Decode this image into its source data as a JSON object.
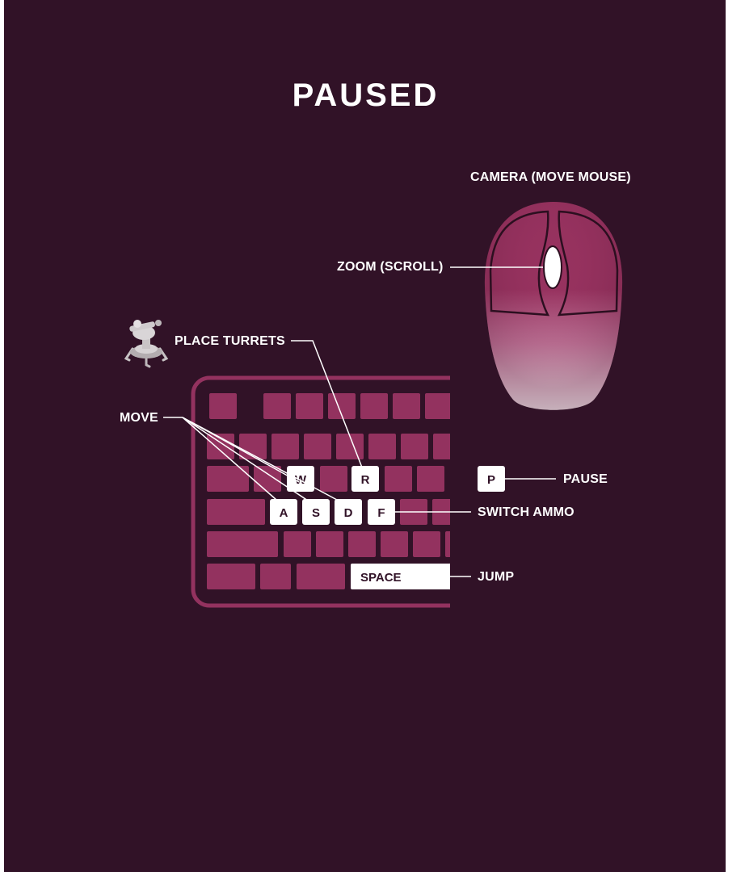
{
  "title": "PAUSED",
  "colors": {
    "background": "#311227",
    "key": "#93325f",
    "highlight_key": "#ffffff",
    "text": "#ffffff"
  },
  "labels": {
    "camera": "CAMERA (MOVE MOUSE)",
    "zoom": "ZOOM (SCROLL)",
    "place_turrets": "PLACE TURRETS",
    "move": "MOVE",
    "pause": "PAUSE",
    "switch_ammo": "SWITCH AMMO",
    "jump": "JUMP"
  },
  "keys": {
    "w": "W",
    "a": "A",
    "s": "S",
    "d": "D",
    "r": "R",
    "f": "F",
    "p": "P",
    "space": "SPACE"
  },
  "icons": {
    "turret": "turret-icon",
    "mouse": "mouse-icon",
    "keyboard": "keyboard-icon"
  }
}
